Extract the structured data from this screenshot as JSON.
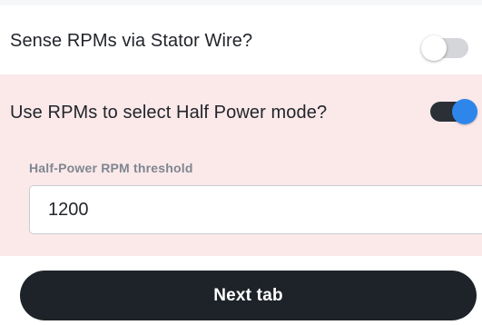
{
  "settings": {
    "sense_rpm": {
      "label": "Sense RPMs via Stator Wire?",
      "enabled": false
    },
    "half_power": {
      "label": "Use RPMs to select Half Power mode?",
      "enabled": true,
      "threshold_label": "Half-Power RPM threshold",
      "threshold_value": "1200"
    }
  },
  "footer": {
    "next_label": "Next tab"
  },
  "colors": {
    "section_highlight": "#fbe9ea",
    "toggle_on_track": "#2b3037",
    "toggle_on_knob": "#2f86ea",
    "toggle_off_track": "#d4d6da",
    "primary_button": "#1e2329"
  }
}
